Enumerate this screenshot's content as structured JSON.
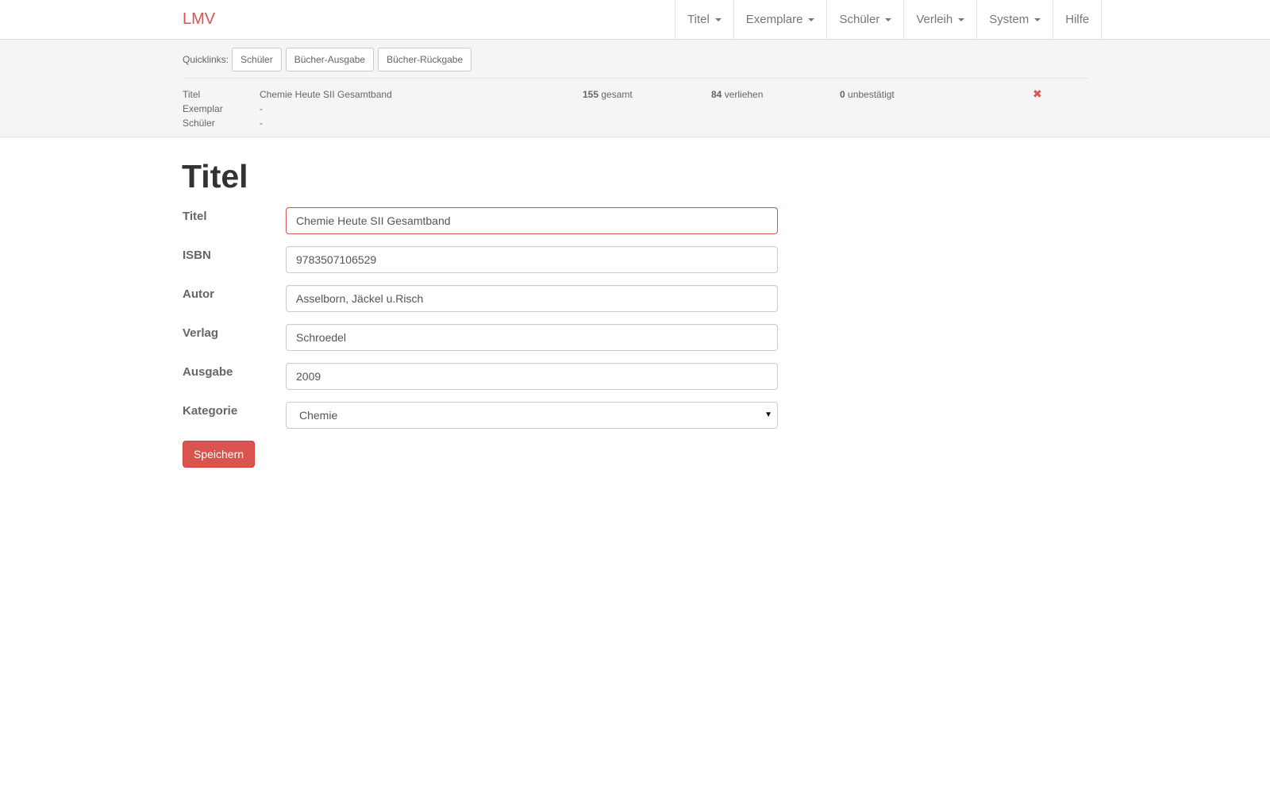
{
  "navbar": {
    "brand": "LMV",
    "menu": [
      {
        "label": "Titel",
        "dropdown": true
      },
      {
        "label": "Exemplare",
        "dropdown": true
      },
      {
        "label": "Schüler",
        "dropdown": true
      },
      {
        "label": "Verleih",
        "dropdown": true
      },
      {
        "label": "System",
        "dropdown": true
      },
      {
        "label": "Hilfe",
        "dropdown": false
      }
    ]
  },
  "quicklinks": {
    "label": "Quicklinks:",
    "buttons": [
      "Schüler",
      "Bücher-Ausgabe",
      "Bücher-Rückgabe"
    ]
  },
  "info": {
    "rows": [
      {
        "key": "Titel",
        "value": "Chemie Heute SII Gesamtband"
      },
      {
        "key": "Exemplar",
        "value": "-"
      },
      {
        "key": "Schüler",
        "value": "-"
      }
    ],
    "stats": {
      "total_count": "155",
      "total_label": "gesamt",
      "lent_count": "84",
      "lent_label": "verliehen",
      "unconfirmed_count": "0",
      "unconfirmed_label": "unbestätigt"
    },
    "close_glyph": "✖"
  },
  "page": {
    "title": "Titel"
  },
  "form": {
    "title_label": "Titel",
    "title_value": "Chemie Heute SII Gesamtband",
    "isbn_label": "ISBN",
    "isbn_value": "9783507106529",
    "author_label": "Autor",
    "author_value": "Asselborn, Jäckel u.Risch",
    "publisher_label": "Verlag",
    "publisher_value": "Schroedel",
    "edition_label": "Ausgabe",
    "edition_value": "2009",
    "category_label": "Kategorie",
    "category_value": "Chemie",
    "save_label": "Speichern"
  },
  "colors": {
    "accent": "#d9534f",
    "panel_bg": "#f5f5f5"
  }
}
